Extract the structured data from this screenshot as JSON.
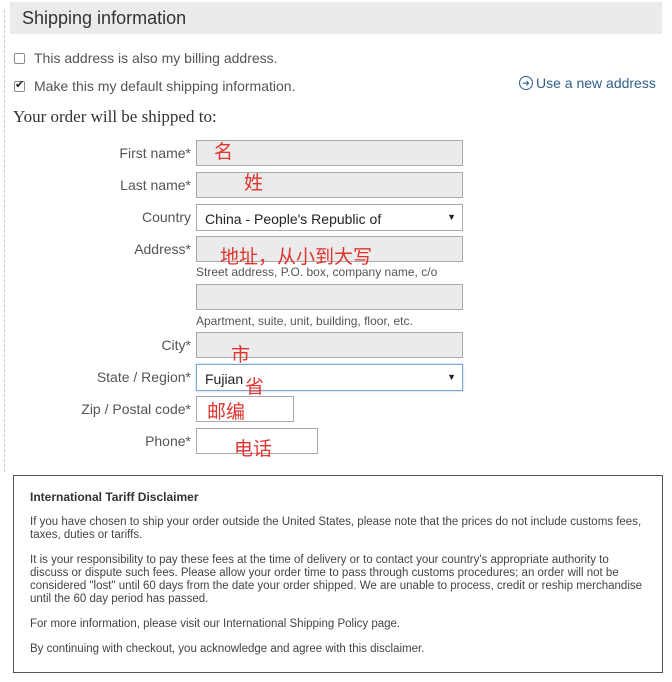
{
  "header": {
    "title": "Shipping information"
  },
  "options": {
    "billing": {
      "label": "This address is also my billing address.",
      "checked": false
    },
    "default_shipping": {
      "label": "Make this my default shipping information.",
      "checked": true
    }
  },
  "use_new_address": {
    "label": "Use a new address",
    "icon": "circle-arrow-right-icon"
  },
  "shipped_to": "Your order will be shipped to:",
  "form": {
    "first_name": {
      "label": "First name*",
      "value": "",
      "annotation": "名"
    },
    "last_name": {
      "label": "Last name*",
      "value": "",
      "annotation": "姓"
    },
    "country": {
      "label": "Country",
      "value": "China - People's Republic of"
    },
    "address": {
      "label": "Address*",
      "value": "",
      "hint": "Street address, P.O. box, company name, c/o",
      "annotation": "地址，从小到大写"
    },
    "address2": {
      "value": "",
      "hint": "Apartment, suite, unit, building, floor, etc."
    },
    "city": {
      "label": "City*",
      "value": "",
      "annotation": "市"
    },
    "state": {
      "label": "State / Region*",
      "value": "Fujian",
      "annotation": "省"
    },
    "zip": {
      "label": "Zip / Postal code*",
      "value": "",
      "annotation": "邮编"
    },
    "phone": {
      "label": "Phone*",
      "value": "",
      "annotation": "电话"
    }
  },
  "disclaimer": {
    "title": "International Tariff Disclaimer",
    "p1": "If you have chosen to ship your order outside the United States, please note that the prices do not include customs fees, taxes, duties or tariffs.",
    "p2": "It is your responsibility to pay these fees at the time of delivery or to contact your country's appropriate authority to discuss or dispute such fees. Please allow your order time to pass through customs procedures; an order will not be considered \"lost\" until 60 days from the date your order shipped. We are unable to process, credit or reship merchandise until the 60 day period has passed.",
    "p3": "For more information, please visit our International Shipping Policy page.",
    "p4": "By continuing with checkout, you acknowledge and agree with this disclaimer."
  }
}
